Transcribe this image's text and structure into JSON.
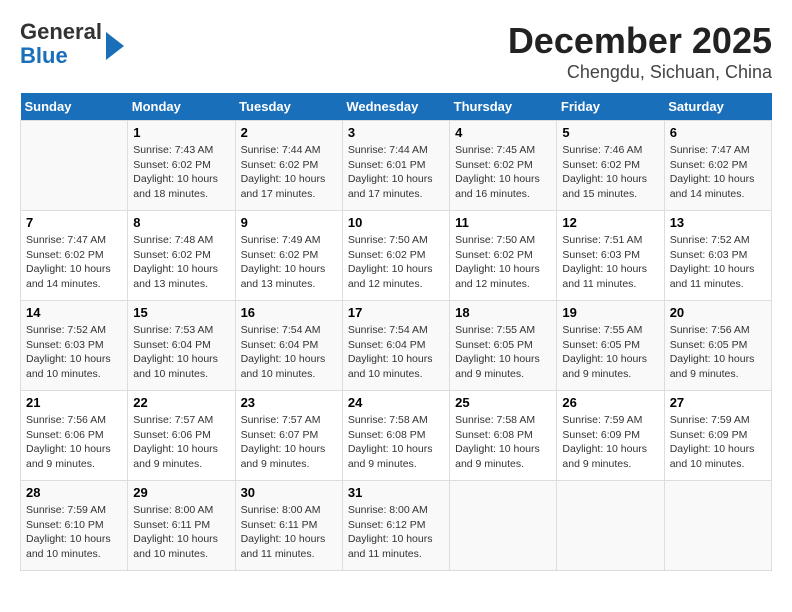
{
  "header": {
    "logo_line1": "General",
    "logo_line2": "Blue",
    "title": "December 2025",
    "subtitle": "Chengdu, Sichuan, China"
  },
  "days_of_week": [
    "Sunday",
    "Monday",
    "Tuesday",
    "Wednesday",
    "Thursday",
    "Friday",
    "Saturday"
  ],
  "weeks": [
    [
      {
        "day": "",
        "info": ""
      },
      {
        "day": "1",
        "info": "Sunrise: 7:43 AM\nSunset: 6:02 PM\nDaylight: 10 hours\nand 18 minutes."
      },
      {
        "day": "2",
        "info": "Sunrise: 7:44 AM\nSunset: 6:02 PM\nDaylight: 10 hours\nand 17 minutes."
      },
      {
        "day": "3",
        "info": "Sunrise: 7:44 AM\nSunset: 6:01 PM\nDaylight: 10 hours\nand 17 minutes."
      },
      {
        "day": "4",
        "info": "Sunrise: 7:45 AM\nSunset: 6:02 PM\nDaylight: 10 hours\nand 16 minutes."
      },
      {
        "day": "5",
        "info": "Sunrise: 7:46 AM\nSunset: 6:02 PM\nDaylight: 10 hours\nand 15 minutes."
      },
      {
        "day": "6",
        "info": "Sunrise: 7:47 AM\nSunset: 6:02 PM\nDaylight: 10 hours\nand 14 minutes."
      }
    ],
    [
      {
        "day": "7",
        "info": "Sunrise: 7:47 AM\nSunset: 6:02 PM\nDaylight: 10 hours\nand 14 minutes."
      },
      {
        "day": "8",
        "info": "Sunrise: 7:48 AM\nSunset: 6:02 PM\nDaylight: 10 hours\nand 13 minutes."
      },
      {
        "day": "9",
        "info": "Sunrise: 7:49 AM\nSunset: 6:02 PM\nDaylight: 10 hours\nand 13 minutes."
      },
      {
        "day": "10",
        "info": "Sunrise: 7:50 AM\nSunset: 6:02 PM\nDaylight: 10 hours\nand 12 minutes."
      },
      {
        "day": "11",
        "info": "Sunrise: 7:50 AM\nSunset: 6:02 PM\nDaylight: 10 hours\nand 12 minutes."
      },
      {
        "day": "12",
        "info": "Sunrise: 7:51 AM\nSunset: 6:03 PM\nDaylight: 10 hours\nand 11 minutes."
      },
      {
        "day": "13",
        "info": "Sunrise: 7:52 AM\nSunset: 6:03 PM\nDaylight: 10 hours\nand 11 minutes."
      }
    ],
    [
      {
        "day": "14",
        "info": "Sunrise: 7:52 AM\nSunset: 6:03 PM\nDaylight: 10 hours\nand 10 minutes."
      },
      {
        "day": "15",
        "info": "Sunrise: 7:53 AM\nSunset: 6:04 PM\nDaylight: 10 hours\nand 10 minutes."
      },
      {
        "day": "16",
        "info": "Sunrise: 7:54 AM\nSunset: 6:04 PM\nDaylight: 10 hours\nand 10 minutes."
      },
      {
        "day": "17",
        "info": "Sunrise: 7:54 AM\nSunset: 6:04 PM\nDaylight: 10 hours\nand 10 minutes."
      },
      {
        "day": "18",
        "info": "Sunrise: 7:55 AM\nSunset: 6:05 PM\nDaylight: 10 hours\nand 9 minutes."
      },
      {
        "day": "19",
        "info": "Sunrise: 7:55 AM\nSunset: 6:05 PM\nDaylight: 10 hours\nand 9 minutes."
      },
      {
        "day": "20",
        "info": "Sunrise: 7:56 AM\nSunset: 6:05 PM\nDaylight: 10 hours\nand 9 minutes."
      }
    ],
    [
      {
        "day": "21",
        "info": "Sunrise: 7:56 AM\nSunset: 6:06 PM\nDaylight: 10 hours\nand 9 minutes."
      },
      {
        "day": "22",
        "info": "Sunrise: 7:57 AM\nSunset: 6:06 PM\nDaylight: 10 hours\nand 9 minutes."
      },
      {
        "day": "23",
        "info": "Sunrise: 7:57 AM\nSunset: 6:07 PM\nDaylight: 10 hours\nand 9 minutes."
      },
      {
        "day": "24",
        "info": "Sunrise: 7:58 AM\nSunset: 6:08 PM\nDaylight: 10 hours\nand 9 minutes."
      },
      {
        "day": "25",
        "info": "Sunrise: 7:58 AM\nSunset: 6:08 PM\nDaylight: 10 hours\nand 9 minutes."
      },
      {
        "day": "26",
        "info": "Sunrise: 7:59 AM\nSunset: 6:09 PM\nDaylight: 10 hours\nand 9 minutes."
      },
      {
        "day": "27",
        "info": "Sunrise: 7:59 AM\nSunset: 6:09 PM\nDaylight: 10 hours\nand 10 minutes."
      }
    ],
    [
      {
        "day": "28",
        "info": "Sunrise: 7:59 AM\nSunset: 6:10 PM\nDaylight: 10 hours\nand 10 minutes."
      },
      {
        "day": "29",
        "info": "Sunrise: 8:00 AM\nSunset: 6:11 PM\nDaylight: 10 hours\nand 10 minutes."
      },
      {
        "day": "30",
        "info": "Sunrise: 8:00 AM\nSunset: 6:11 PM\nDaylight: 10 hours\nand 11 minutes."
      },
      {
        "day": "31",
        "info": "Sunrise: 8:00 AM\nSunset: 6:12 PM\nDaylight: 10 hours\nand 11 minutes."
      },
      {
        "day": "",
        "info": ""
      },
      {
        "day": "",
        "info": ""
      },
      {
        "day": "",
        "info": ""
      }
    ]
  ]
}
